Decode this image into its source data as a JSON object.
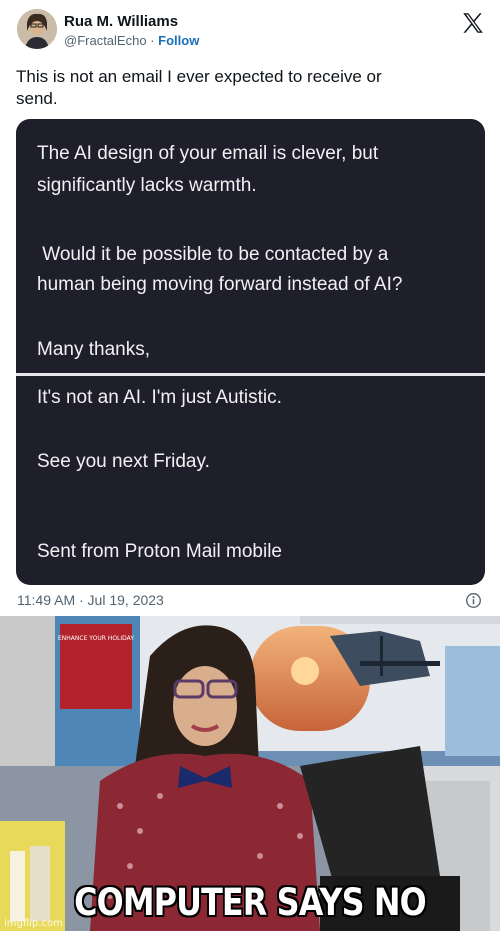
{
  "author": {
    "name": "Rua M. Williams",
    "handle": "@FractalEcho",
    "separator": "·",
    "follow_label": "Follow"
  },
  "tweet": {
    "text_line1": "This is not an email I ever expected to receive or",
    "text_line2": "send.",
    "timestamp": "11:49 AM · Jul 19, 2023"
  },
  "email_card": {
    "received": {
      "line1": "The AI design of your email is clever, but",
      "line2": "significantly lacks warmth.",
      "line3": " Would it be possible to be contacted by a",
      "line4": "human being moving forward instead of AI?",
      "line5": "Many thanks,"
    },
    "reply": {
      "line1": "It's not an AI. I'm just Autistic.",
      "line2": "See you next Friday.",
      "line3": "Sent from Proton Mail mobile"
    }
  },
  "meme": {
    "caption": "COMPUTER SAYS NO",
    "watermark": "imgflip.com",
    "poster_text": "ENHANCE YOUR HOLIDAY"
  },
  "icons": {
    "platform_logo": "x-logo-icon",
    "info": "info-icon"
  },
  "colors": {
    "card_background": "#1f1e2b",
    "follow_link": "#1d70b8",
    "secondary_text": "#536471"
  }
}
